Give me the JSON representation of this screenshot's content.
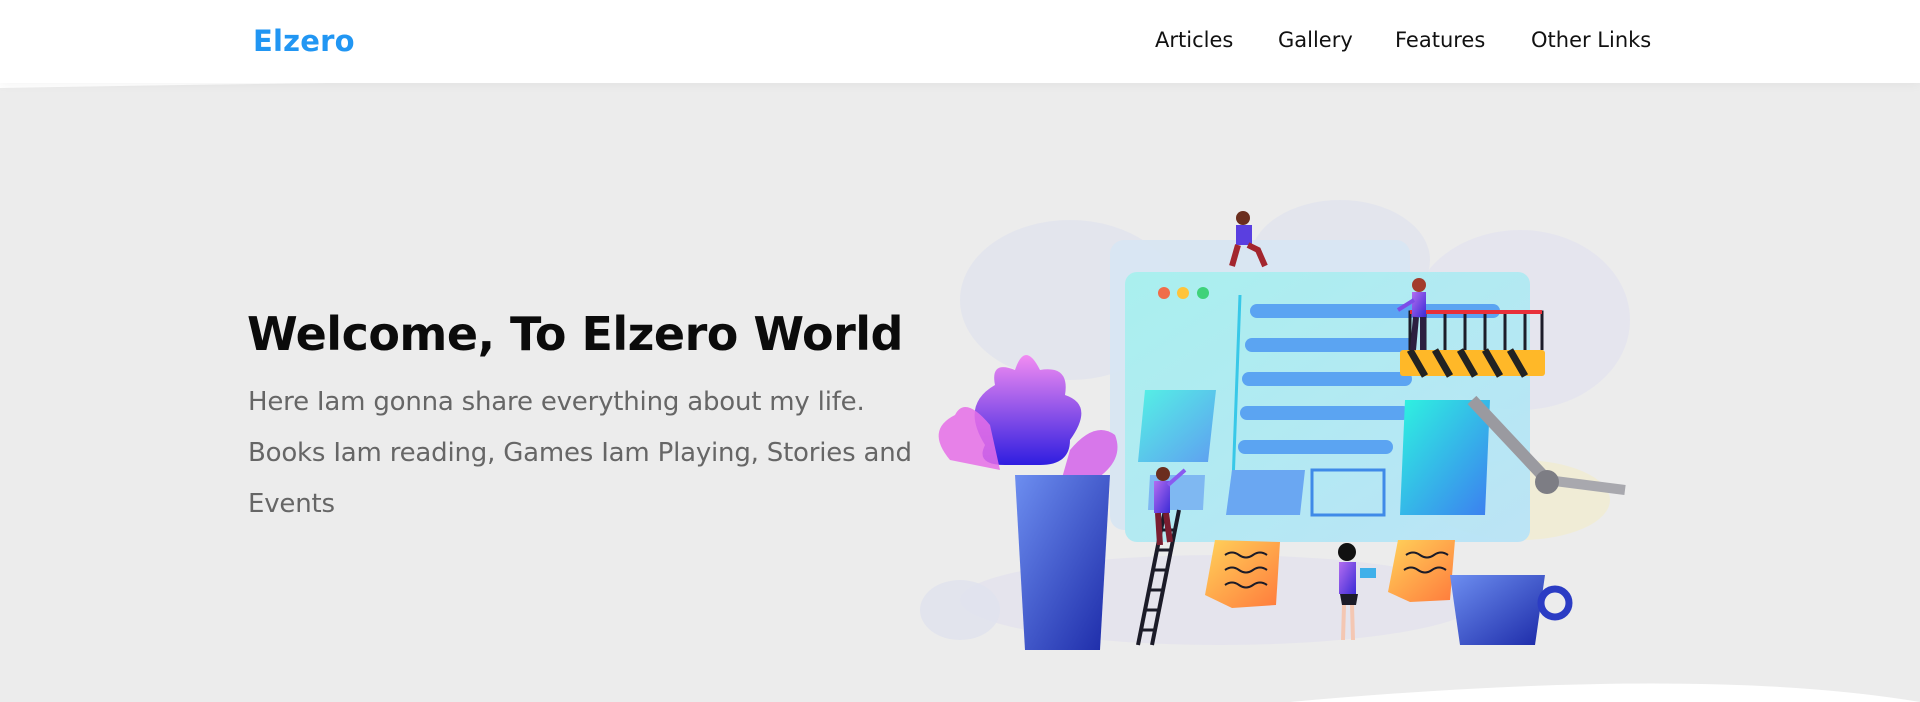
{
  "header": {
    "logo": "Elzero",
    "nav": [
      {
        "label": "Articles"
      },
      {
        "label": "Gallery"
      },
      {
        "label": "Features"
      },
      {
        "label": "Other Links"
      }
    ]
  },
  "hero": {
    "title": "Welcome, To Elzero World",
    "description": "Here Iam gonna share everything about my life. Books Iam reading, Games Iam Playing, Stories and Events"
  },
  "colors": {
    "brand": "#2196f3",
    "hero_background": "#ececec",
    "text_dark": "#0b0b0b",
    "text_muted": "#666666"
  }
}
